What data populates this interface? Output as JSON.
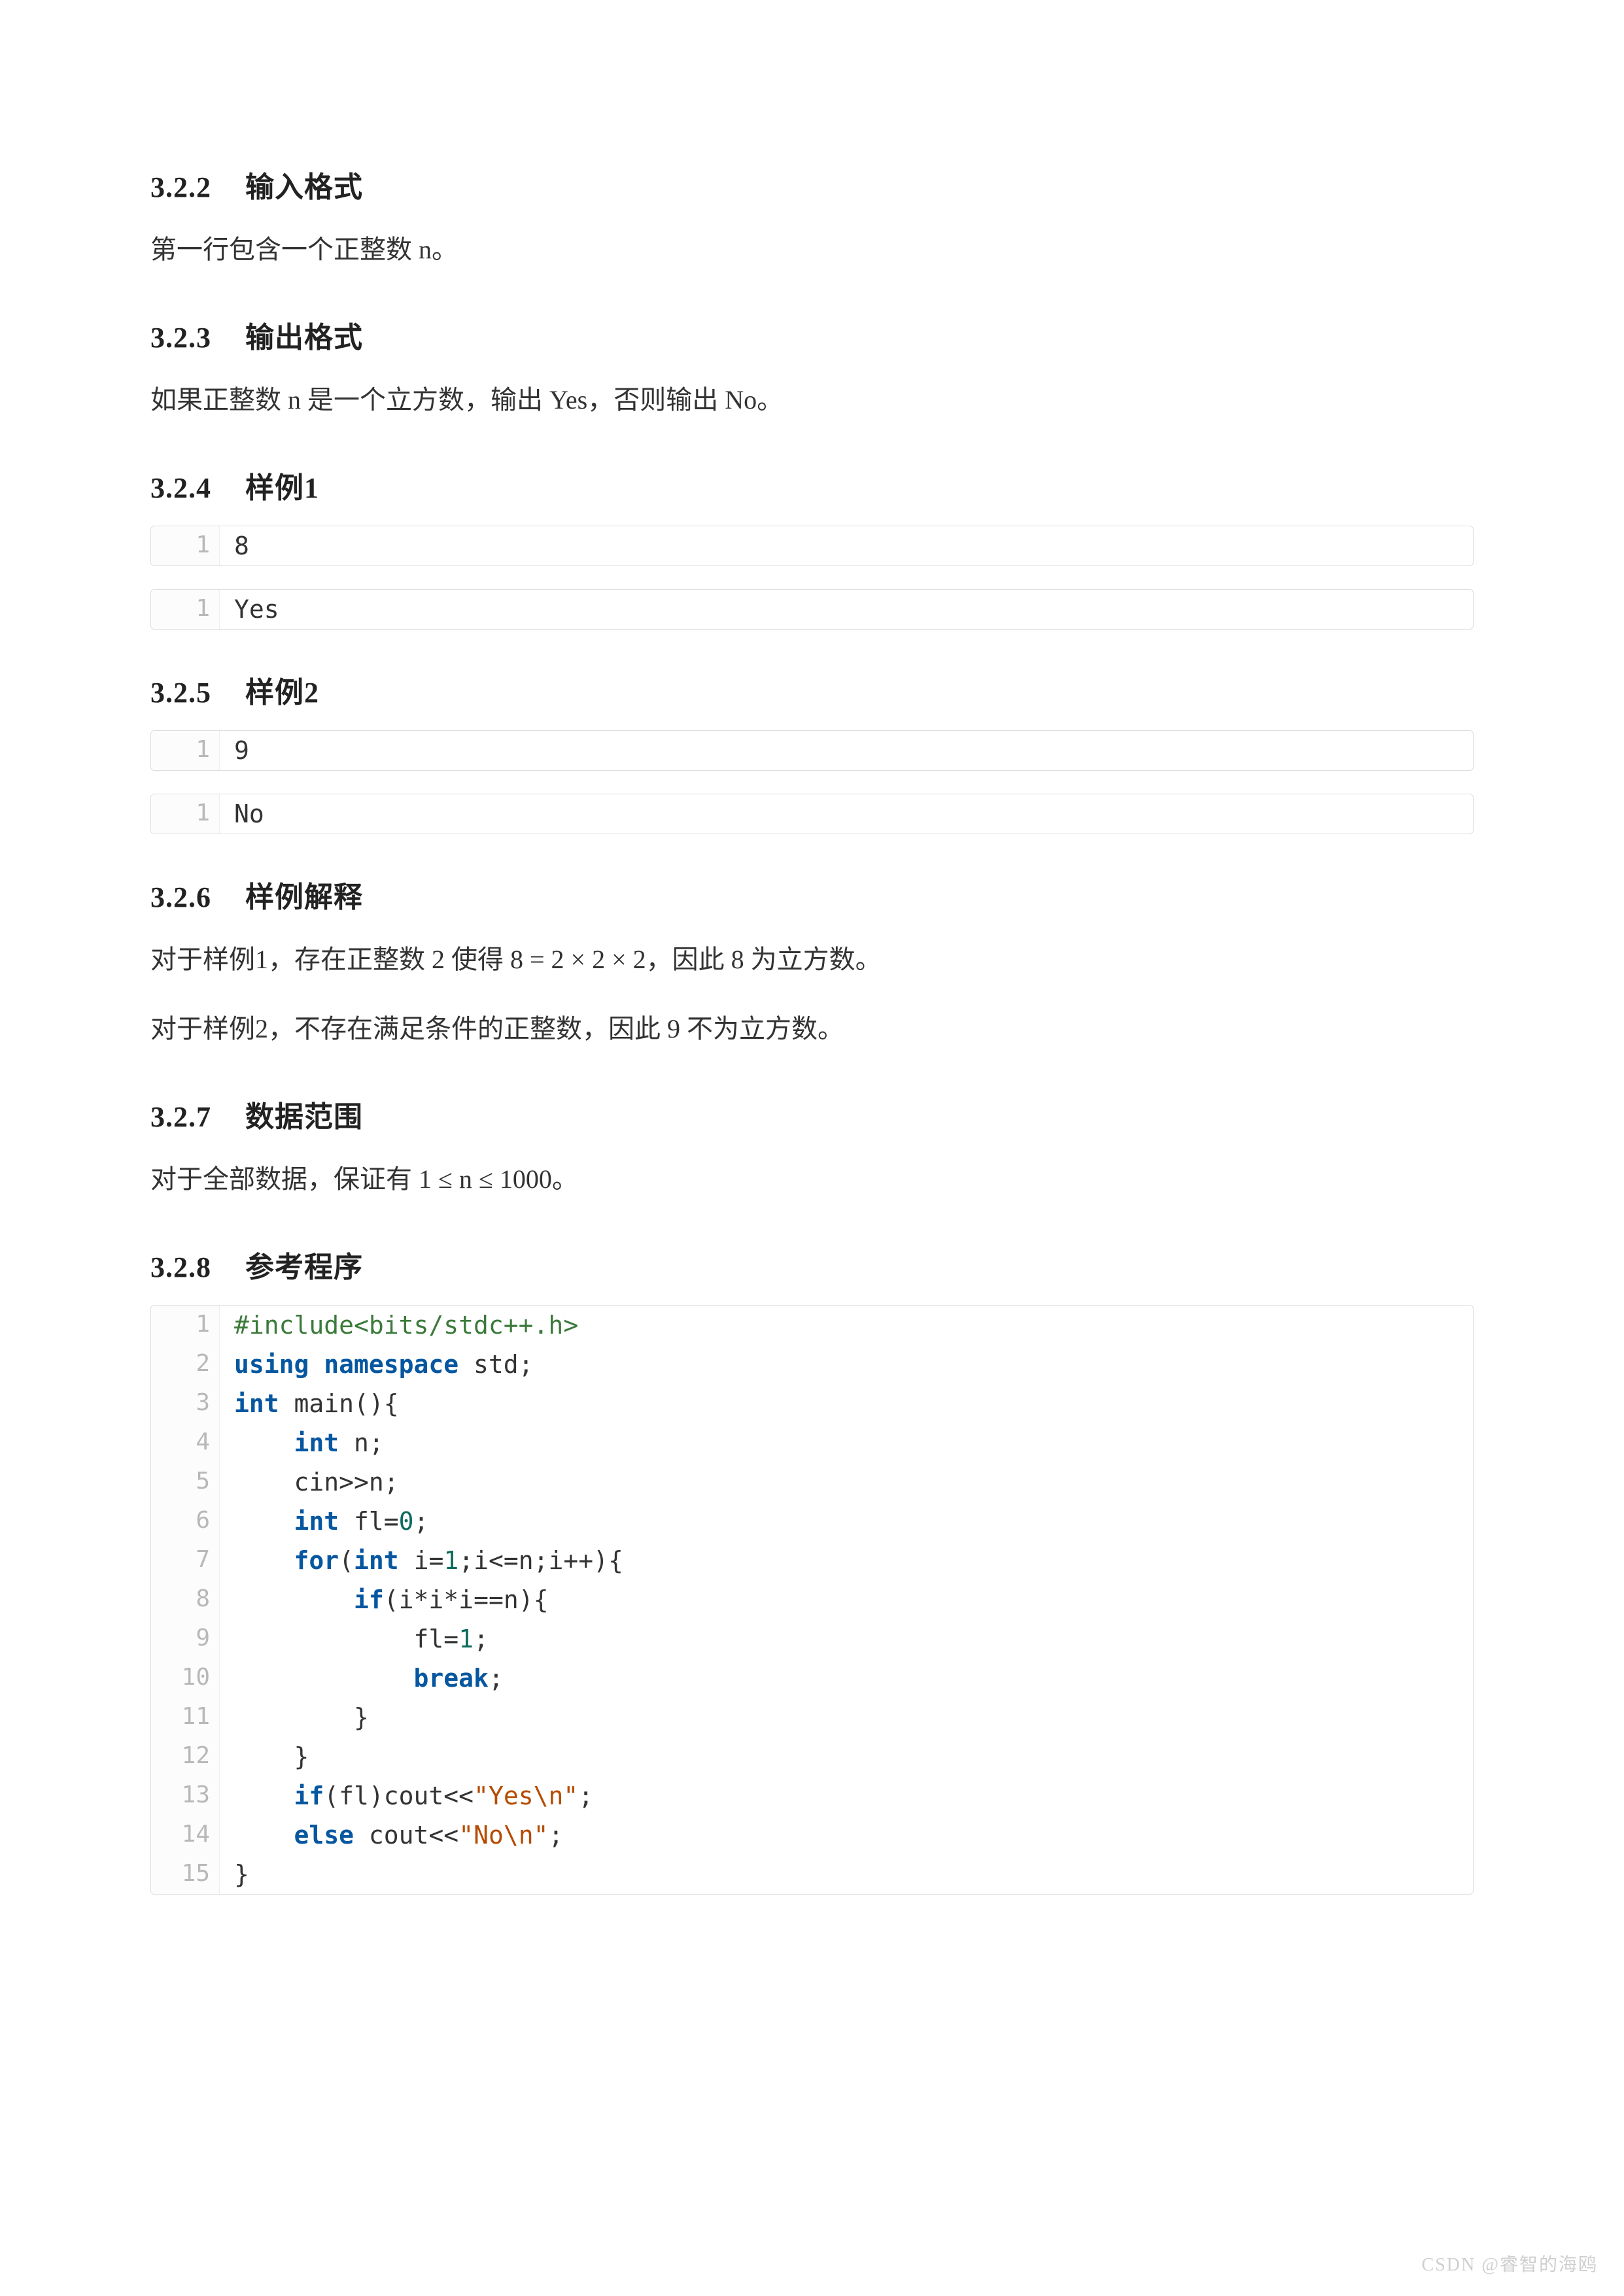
{
  "sections": {
    "s322": {
      "num": "3.2.2",
      "title": "输入格式"
    },
    "s323": {
      "num": "3.2.3",
      "title": "输出格式"
    },
    "s324": {
      "num": "3.2.4",
      "title": "样例1"
    },
    "s325": {
      "num": "3.2.5",
      "title": "样例2"
    },
    "s326": {
      "num": "3.2.6",
      "title": "样例解释"
    },
    "s327": {
      "num": "3.2.7",
      "title": "数据范围"
    },
    "s328": {
      "num": "3.2.8",
      "title": "参考程序"
    }
  },
  "paras": {
    "p_input": "第一行包含一个正整数 n。",
    "p_output": "如果正整数 n 是一个立方数，输出 Yes，否则输出 No。",
    "p_expl1": "对于样例1，存在正整数 2 使得 8 = 2 × 2 × 2，因此 8 为立方数。",
    "p_expl2": "对于样例2，不存在满足条件的正整数，因此 9 不为立方数。",
    "p_range": "对于全部数据，保证有 1 ≤ n ≤ 1000。"
  },
  "samples": {
    "s1_in": {
      "lineno": "1",
      "text": "8"
    },
    "s1_out": {
      "lineno": "1",
      "text": "Yes"
    },
    "s2_in": {
      "lineno": "1",
      "text": "9"
    },
    "s2_out": {
      "lineno": "1",
      "text": "No"
    }
  },
  "program": {
    "linenos": [
      "1",
      "2",
      "3",
      "4",
      "5",
      "6",
      "7",
      "8",
      "9",
      "10",
      "11",
      "12",
      "13",
      "14",
      "15"
    ],
    "tokens": {
      "l1_a": "#include<bits/stdc++.h>",
      "l2_a": "using",
      "l2_b": " namespace",
      "l2_c": " std;",
      "l3_a": "int",
      "l3_b": " main(){",
      "l4_ws": "    ",
      "l4_a": "int",
      "l4_b": " n;",
      "l5_ws": "    ",
      "l5_a": "cin>>n;",
      "l6_ws": "    ",
      "l6_a": "int",
      "l6_b": " fl=",
      "l6_c": "0",
      "l6_d": ";",
      "l7_ws": "    ",
      "l7_a": "for",
      "l7_b": "(",
      "l7_c": "int",
      "l7_d": " i=",
      "l7_e": "1",
      "l7_f": ";i<=n;i++){",
      "l8_ws": "        ",
      "l8_a": "if",
      "l8_b": "(i*i*i==n){",
      "l9_ws": "            ",
      "l9_a": "fl=",
      "l9_b": "1",
      "l9_c": ";",
      "l10_ws": "            ",
      "l10_a": "break",
      "l10_b": ";",
      "l11_ws": "        ",
      "l11_a": "}",
      "l12_ws": "    ",
      "l12_a": "}",
      "l13_ws": "    ",
      "l13_a": "if",
      "l13_b": "(fl)cout<<",
      "l13_c": "\"Yes\\n\"",
      "l13_d": ";",
      "l14_ws": "    ",
      "l14_a": "else",
      "l14_b": " cout<<",
      "l14_c": "\"No\\n\"",
      "l14_d": ";",
      "l15_a": "}"
    }
  },
  "watermark": "CSDN @睿智的海鸥"
}
